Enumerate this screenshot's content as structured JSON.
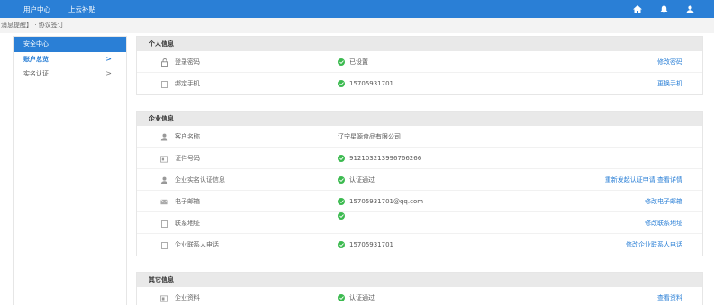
{
  "topbar": {
    "nav": [
      "用户中心",
      "上云补贴"
    ],
    "icons": [
      "home-icon",
      "bell-icon",
      "user-icon"
    ]
  },
  "breadcrumb": "消息提醒】 · 协议签订",
  "sidebar": {
    "title": "安全中心",
    "items": [
      {
        "label": "账户总览",
        "active": true,
        "chevron": ">"
      },
      {
        "label": "实名认证",
        "active": false,
        "chevron": ">"
      }
    ]
  },
  "sections": {
    "personal": {
      "title": "个人信息",
      "rows": [
        {
          "icon": "lock-icon",
          "label": "登录密码",
          "value": "已设置",
          "verified": true,
          "action": "修改密码"
        },
        {
          "icon": "phone-icon",
          "label": "绑定手机",
          "value": "15705931701",
          "verified": true,
          "action": "更换手机"
        }
      ]
    },
    "company": {
      "title": "企业信息",
      "rows": [
        {
          "icon": "person-icon",
          "label": "客户名称",
          "value": "辽宁星源食品有限公司",
          "verified": false,
          "action": ""
        },
        {
          "icon": "id-card-icon",
          "label": "证件号码",
          "value": "912103213996766266",
          "verified": true,
          "action": ""
        },
        {
          "icon": "person-icon",
          "label": "企业实名认证信息",
          "value": "认证通过",
          "verified": true,
          "action": "重新发起认证申请  查看详情"
        },
        {
          "icon": "mail-icon",
          "label": "电子邮箱",
          "value": "15705931701@qq.com",
          "verified": true,
          "action": "修改电子邮箱"
        },
        {
          "icon": "address-icon",
          "label": "联系地址",
          "value": "",
          "verified": true,
          "action": "修改联系地址"
        },
        {
          "icon": "phone-icon",
          "label": "企业联系人电话",
          "value": "15705931701",
          "verified": true,
          "action": "修改企业联系人电话"
        }
      ]
    },
    "other": {
      "title": "其它信息",
      "rows": [
        {
          "icon": "document-icon",
          "label": "企业资料",
          "value": "认证通过",
          "verified": true,
          "action": "查看资料"
        }
      ]
    }
  },
  "colors": {
    "brand": "#2a7fd6",
    "success": "#3bba4f",
    "header_bg": "#e9e9e9"
  }
}
